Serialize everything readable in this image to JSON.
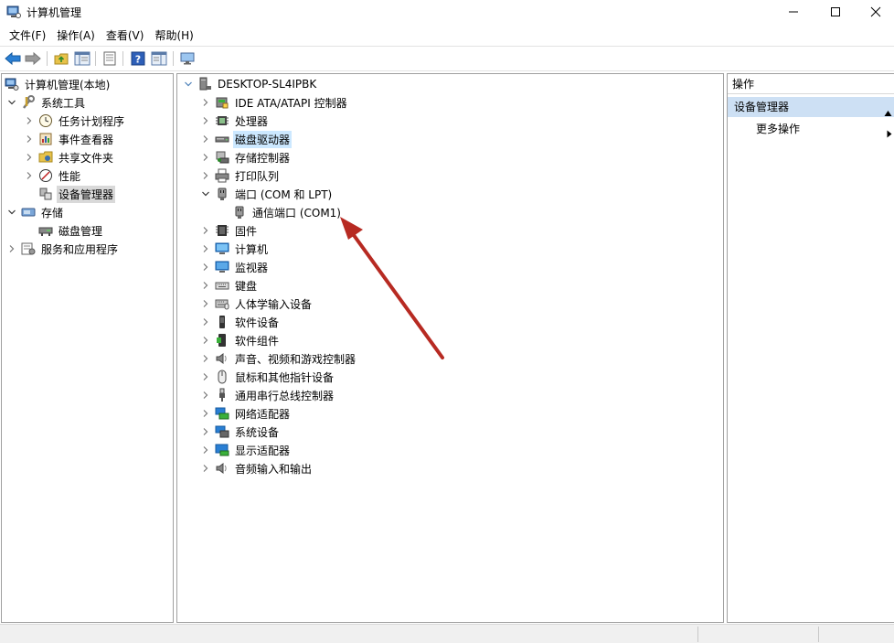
{
  "window": {
    "title": "计算机管理",
    "controls": [
      "minimize",
      "maximize",
      "close"
    ]
  },
  "menubar": {
    "items": [
      "文件(F)",
      "操作(A)",
      "查看(V)",
      "帮助(H)"
    ]
  },
  "toolbar": {
    "buttons": [
      "back-icon",
      "forward-icon",
      "up-folder-icon",
      "show-hide-tree-icon",
      "properties-icon",
      "help-icon",
      "action-pane-icon",
      "monitor-icon"
    ]
  },
  "left_tree": {
    "items": [
      {
        "label": "计算机管理(本地)",
        "icon": "computer-management-icon",
        "level": 0,
        "expander": "none"
      },
      {
        "label": "系统工具",
        "icon": "tools-icon",
        "level": 1,
        "expander": "expanded"
      },
      {
        "label": "任务计划程序",
        "icon": "clock-icon",
        "level": 2,
        "expander": "collapsed"
      },
      {
        "label": "事件查看器",
        "icon": "event-viewer-icon",
        "level": 2,
        "expander": "collapsed"
      },
      {
        "label": "共享文件夹",
        "icon": "shared-folder-icon",
        "level": 2,
        "expander": "collapsed"
      },
      {
        "label": "性能",
        "icon": "performance-icon",
        "level": 2,
        "expander": "collapsed"
      },
      {
        "label": "设备管理器",
        "icon": "device-manager-icon",
        "level": 2,
        "expander": "none",
        "selected": true
      },
      {
        "label": "存储",
        "icon": "storage-icon",
        "level": 1,
        "expander": "expanded"
      },
      {
        "label": "磁盘管理",
        "icon": "disk-management-icon",
        "level": 2,
        "expander": "none"
      },
      {
        "label": "服务和应用程序",
        "icon": "services-icon",
        "level": 1,
        "expander": "collapsed"
      }
    ]
  },
  "device_tree": {
    "root": "DESKTOP-SL4IPBK",
    "items": [
      {
        "label": "IDE ATA/ATAPI 控制器",
        "icon": "ide-controller-icon",
        "expander": "collapsed"
      },
      {
        "label": "处理器",
        "icon": "processor-icon",
        "expander": "collapsed"
      },
      {
        "label": "磁盘驱动器",
        "icon": "disk-drive-icon",
        "expander": "collapsed",
        "highlighted": true
      },
      {
        "label": "存储控制器",
        "icon": "storage-controller-icon",
        "expander": "collapsed"
      },
      {
        "label": "打印队列",
        "icon": "printer-icon",
        "expander": "collapsed"
      },
      {
        "label": "端口 (COM 和 LPT)",
        "icon": "port-icon",
        "expander": "expanded"
      },
      {
        "label": "通信端口 (COM1)",
        "icon": "port-icon",
        "expander": "none",
        "child": true
      },
      {
        "label": "固件",
        "icon": "firmware-icon",
        "expander": "collapsed"
      },
      {
        "label": "计算机",
        "icon": "computer-icon",
        "expander": "collapsed"
      },
      {
        "label": "监视器",
        "icon": "monitor-icon",
        "expander": "collapsed"
      },
      {
        "label": "键盘",
        "icon": "keyboard-icon",
        "expander": "collapsed"
      },
      {
        "label": "人体学输入设备",
        "icon": "hid-icon",
        "expander": "collapsed"
      },
      {
        "label": "软件设备",
        "icon": "software-device-icon",
        "expander": "collapsed"
      },
      {
        "label": "软件组件",
        "icon": "software-component-icon",
        "expander": "collapsed"
      },
      {
        "label": "声音、视频和游戏控制器",
        "icon": "speaker-icon",
        "expander": "collapsed"
      },
      {
        "label": "鼠标和其他指针设备",
        "icon": "mouse-icon",
        "expander": "collapsed"
      },
      {
        "label": "通用串行总线控制器",
        "icon": "usb-icon",
        "expander": "collapsed"
      },
      {
        "label": "网络适配器",
        "icon": "network-adapter-icon",
        "expander": "collapsed"
      },
      {
        "label": "系统设备",
        "icon": "system-device-icon",
        "expander": "collapsed"
      },
      {
        "label": "显示适配器",
        "icon": "display-adapter-icon",
        "expander": "collapsed"
      },
      {
        "label": "音频输入和输出",
        "icon": "audio-io-icon",
        "expander": "collapsed"
      }
    ]
  },
  "actions": {
    "header": "操作",
    "section": "设备管理器",
    "more": "更多操作"
  },
  "annotation": {
    "color": "#b72a22",
    "target": "通信端口 (COM1)"
  },
  "colors": {
    "selection_gray": "#d9d9d9",
    "highlight_blue": "#cce8ff",
    "actions_section": "#cde0f4"
  }
}
